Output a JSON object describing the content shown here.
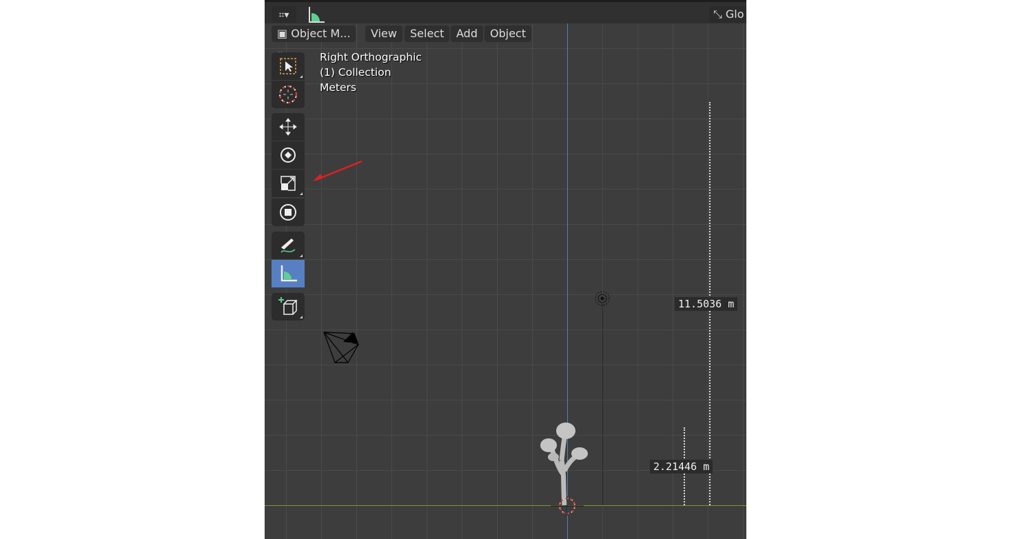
{
  "header": {
    "orientation_label": "Glo",
    "mode_label": "Object M...",
    "menus": [
      "View",
      "Select",
      "Add",
      "Object"
    ]
  },
  "overlay": {
    "view_name": "Right Orthographic",
    "collection": "(1) Collection",
    "units": "Meters"
  },
  "toolbar": {
    "tools": [
      "select-box",
      "cursor",
      "move",
      "rotate",
      "scale",
      "transform",
      "annotate",
      "measure",
      "add-cube"
    ],
    "active_tool": "measure",
    "active_color": "#5680c2"
  },
  "measurements": [
    {
      "value": "11.5036 m"
    },
    {
      "value": "2.21446 m"
    }
  ],
  "colors": {
    "y_axis": "#7a9a2a",
    "z_axis": "#5a7fb0",
    "annotation_arrow": "#e02020"
  }
}
